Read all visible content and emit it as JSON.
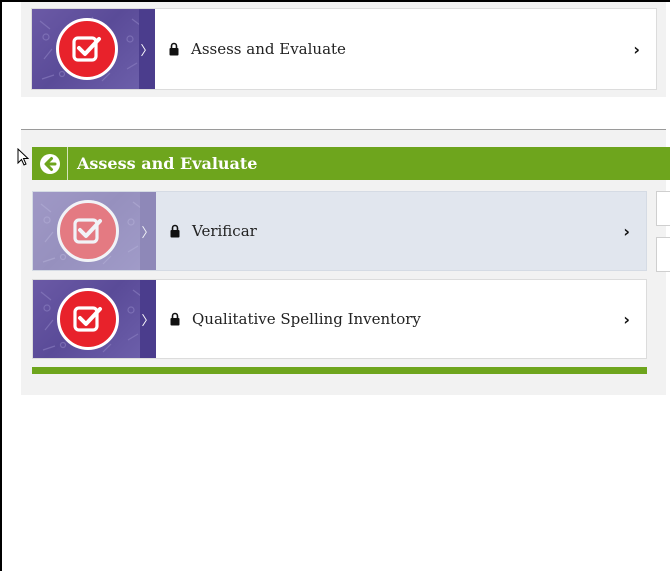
{
  "top_card": {
    "title": "Assess and Evaluate",
    "icon": "checkbox-check-icon",
    "locked": true
  },
  "section": {
    "header_title": "Assess and Evaluate",
    "back_icon": "back-arrow-icon",
    "items": [
      {
        "title": "Verificar",
        "icon": "checkbox-check-icon",
        "locked": true
      },
      {
        "title": "Qualitative Spelling Inventory",
        "icon": "checkbox-check-icon",
        "locked": true
      }
    ]
  },
  "chevron_glyph": "›",
  "strip_glyph": "〉",
  "colors": {
    "green": "#6ea51d",
    "purple": "#5a4b98",
    "red": "#e8222b",
    "panel_bg": "#f2f2f2"
  }
}
